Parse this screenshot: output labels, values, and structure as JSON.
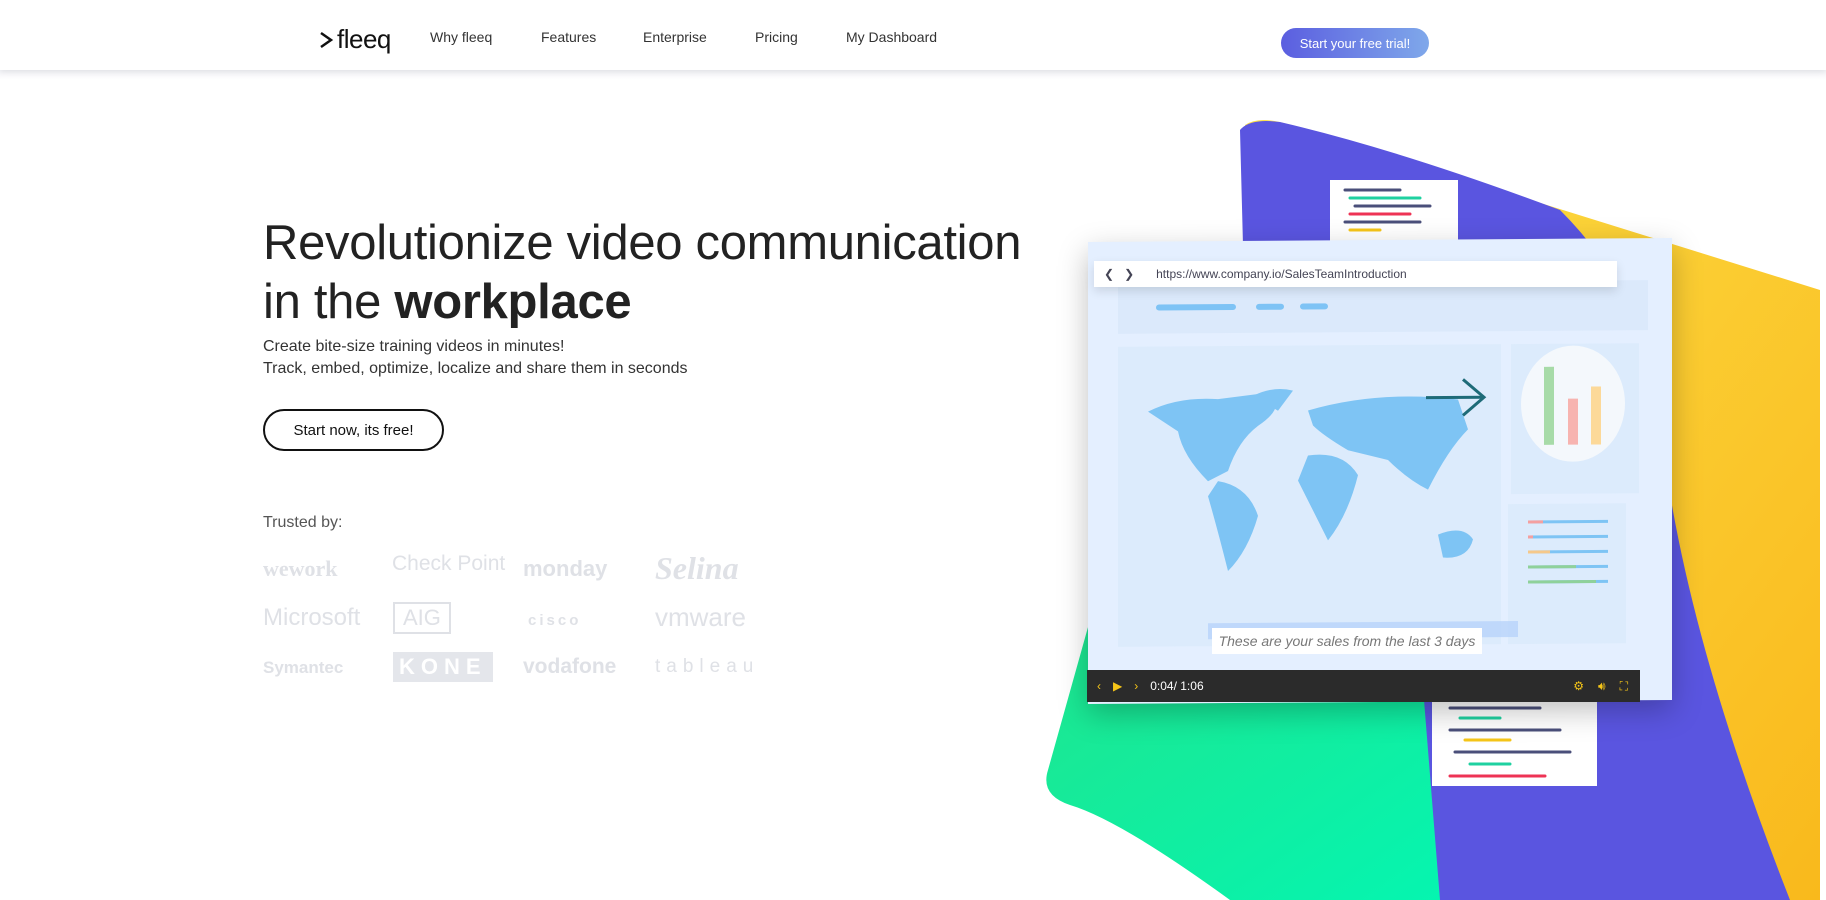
{
  "nav": {
    "brand": "fleeq",
    "links": [
      "Why fleeq",
      "Features",
      "Enterprise",
      "Pricing",
      "My Dashboard"
    ],
    "cta": "Start your free trial!"
  },
  "hero": {
    "title_line1": "Revolutionize video communication",
    "title_prefix": "in the ",
    "title_bold": "workplace",
    "sub1": "Create bite-size training videos in minutes!",
    "sub2": "Track, embed, optimize, localize and share them in seconds",
    "button": "Start now, its free!"
  },
  "trusted": {
    "label": "Trusted by:",
    "logos": [
      "wework",
      "Check Point",
      "monday",
      "Selina",
      "Microsoft",
      "AIG",
      "cisco",
      "vmware",
      "Symantec",
      "KONE",
      "vodafone",
      "tableau"
    ]
  },
  "video": {
    "url": "https://www.company.io/SalesTeamIntroduction",
    "caption": "These are your sales from the last 3 days",
    "time": "0:04/ 1:06"
  },
  "colors": {
    "purple": "#5a55e0",
    "yellow": "#fcd12a",
    "green": "#12e89a",
    "accent": "#6c7ff0"
  }
}
